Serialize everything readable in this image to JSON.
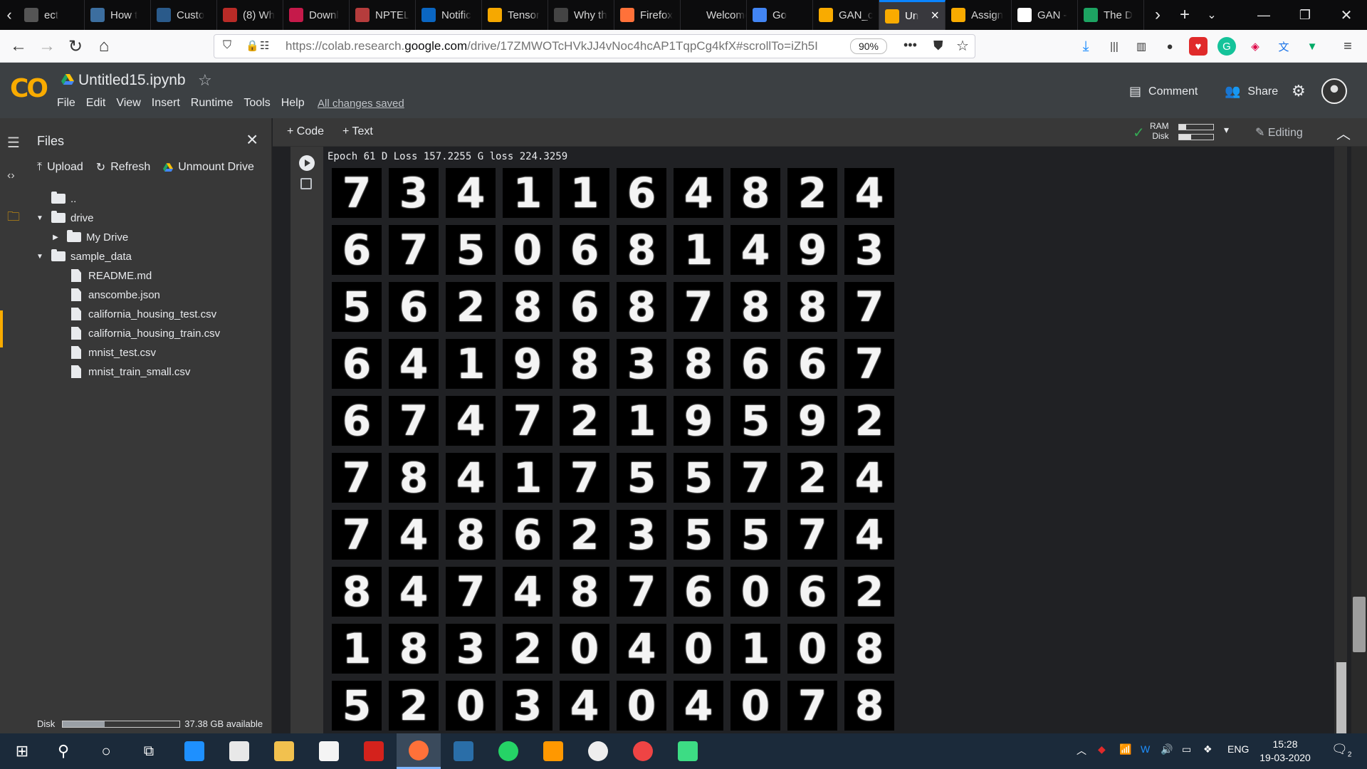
{
  "browser": {
    "tabs": [
      {
        "label": "ect",
        "color": "#555"
      },
      {
        "label": "How t",
        "color": "#3c6e9f"
      },
      {
        "label": "Custo",
        "color": "#2a5a8a"
      },
      {
        "label": "(8) Wh",
        "color": "#b92b27"
      },
      {
        "label": "Downl",
        "color": "#c51a4a"
      },
      {
        "label": "NPTEL",
        "color": "#b53c3c"
      },
      {
        "label": "Notific",
        "color": "#0a66c2"
      },
      {
        "label": "Tensor",
        "color": "#f6a800"
      },
      {
        "label": "Why th",
        "color": "#444"
      },
      {
        "label": "Firefox",
        "color": "#ff7139"
      },
      {
        "label": "Welcome",
        "color": "#0c0c0d"
      },
      {
        "label": "Go",
        "color": "#4285f4"
      },
      {
        "label": "GAN_c",
        "color": "#f9ab00"
      },
      {
        "label": "Un",
        "color": "#f9ab00"
      },
      {
        "label": "Assign",
        "color": "#f9ab00"
      },
      {
        "label": "GAN -",
        "color": "#ffffff"
      },
      {
        "label": "The D",
        "color": "#1da462"
      }
    ],
    "url_prefix": "https://colab.research.",
    "url_domain": "google.com",
    "url_path": "/drive/17ZMWOTcHVkJJ4vNoc4hcAP1TqpCg4kfX#scrollTo=iZh5I",
    "zoom": "90%"
  },
  "colab": {
    "logo": "CO",
    "notebook_title": "Untitled15.ipynb",
    "menus": [
      "File",
      "Edit",
      "View",
      "Insert",
      "Runtime",
      "Tools",
      "Help"
    ],
    "save_status": "All changes saved",
    "comment_label": "Comment",
    "share_label": "Share"
  },
  "sidebar": {
    "title": "Files",
    "upload_label": "Upload",
    "refresh_label": "Refresh",
    "unmount_label": "Unmount Drive",
    "tree": [
      {
        "label": "..",
        "type": "up",
        "indent": 0
      },
      {
        "label": "drive",
        "type": "folder",
        "caret": "down",
        "indent": 0
      },
      {
        "label": "My Drive",
        "type": "folder",
        "caret": "right",
        "indent": 1
      },
      {
        "label": "sample_data",
        "type": "folder",
        "caret": "down",
        "indent": 0
      },
      {
        "label": "README.md",
        "type": "file",
        "indent": 1
      },
      {
        "label": "anscombe.json",
        "type": "file",
        "indent": 1
      },
      {
        "label": "california_housing_test.csv",
        "type": "file",
        "indent": 1
      },
      {
        "label": "california_housing_train.csv",
        "type": "file",
        "indent": 1
      },
      {
        "label": "mnist_test.csv",
        "type": "file",
        "indent": 1
      },
      {
        "label": "mnist_train_small.csv",
        "type": "file",
        "indent": 1
      }
    ],
    "disk_label": "Disk",
    "disk_fraction": 0.36,
    "disk_available": "37.38 GB available"
  },
  "toolbar": {
    "code_label": "+ Code",
    "text_label": "+ Text",
    "ram_label": "RAM",
    "disk_label": "Disk",
    "ram_fraction": 0.2,
    "disk_fraction": 0.35,
    "editing_label": "Editing"
  },
  "cell": {
    "output_line": "Epoch 61 D Loss 157.2255 G loss 224.3259",
    "digit_rows": [
      [
        "7",
        "3",
        "4",
        "1",
        "1",
        "6",
        "4",
        "8",
        "2",
        "4"
      ],
      [
        "6",
        "7",
        "5",
        "0",
        "6",
        "8",
        "1",
        "4",
        "9",
        "3"
      ],
      [
        "5",
        "6",
        "2",
        "8",
        "6",
        "8",
        "7",
        "8",
        "8",
        "7"
      ],
      [
        "6",
        "4",
        "1",
        "9",
        "8",
        "3",
        "8",
        "6",
        "6",
        "7"
      ],
      [
        "6",
        "7",
        "4",
        "7",
        "2",
        "1",
        "9",
        "5",
        "9",
        "2"
      ],
      [
        "7",
        "8",
        "4",
        "1",
        "7",
        "5",
        "5",
        "7",
        "2",
        "4"
      ],
      [
        "7",
        "4",
        "8",
        "6",
        "2",
        "3",
        "5",
        "5",
        "7",
        "4"
      ],
      [
        "8",
        "4",
        "7",
        "4",
        "8",
        "7",
        "6",
        "0",
        "6",
        "2"
      ],
      [
        "1",
        "8",
        "3",
        "2",
        "0",
        "4",
        "0",
        "1",
        "0",
        "8"
      ],
      [
        "5",
        "2",
        "0",
        "3",
        "4",
        "0",
        "4",
        "0",
        "7",
        "8"
      ]
    ]
  },
  "taskbar": {
    "apps": [
      {
        "name": "edge",
        "color": "#1e90ff"
      },
      {
        "name": "store",
        "color": "#e8e8e8"
      },
      {
        "name": "explorer",
        "color": "#f2c14e"
      },
      {
        "name": "mail",
        "color": "#f4f4f4"
      },
      {
        "name": "acrobat",
        "color": "#d4221c"
      },
      {
        "name": "firefox",
        "color": "#ff7139"
      },
      {
        "name": "spyder",
        "color": "#2a6ea8"
      },
      {
        "name": "whatsapp",
        "color": "#25d366"
      },
      {
        "name": "sublime",
        "color": "#ff9800"
      },
      {
        "name": "github",
        "color": "#eeeeee"
      },
      {
        "name": "anydesk",
        "color": "#ef4444"
      },
      {
        "name": "app",
        "color": "#3ddc84"
      }
    ],
    "language": "ENG",
    "time": "15:28",
    "date": "19-03-2020",
    "notifications": "2"
  }
}
